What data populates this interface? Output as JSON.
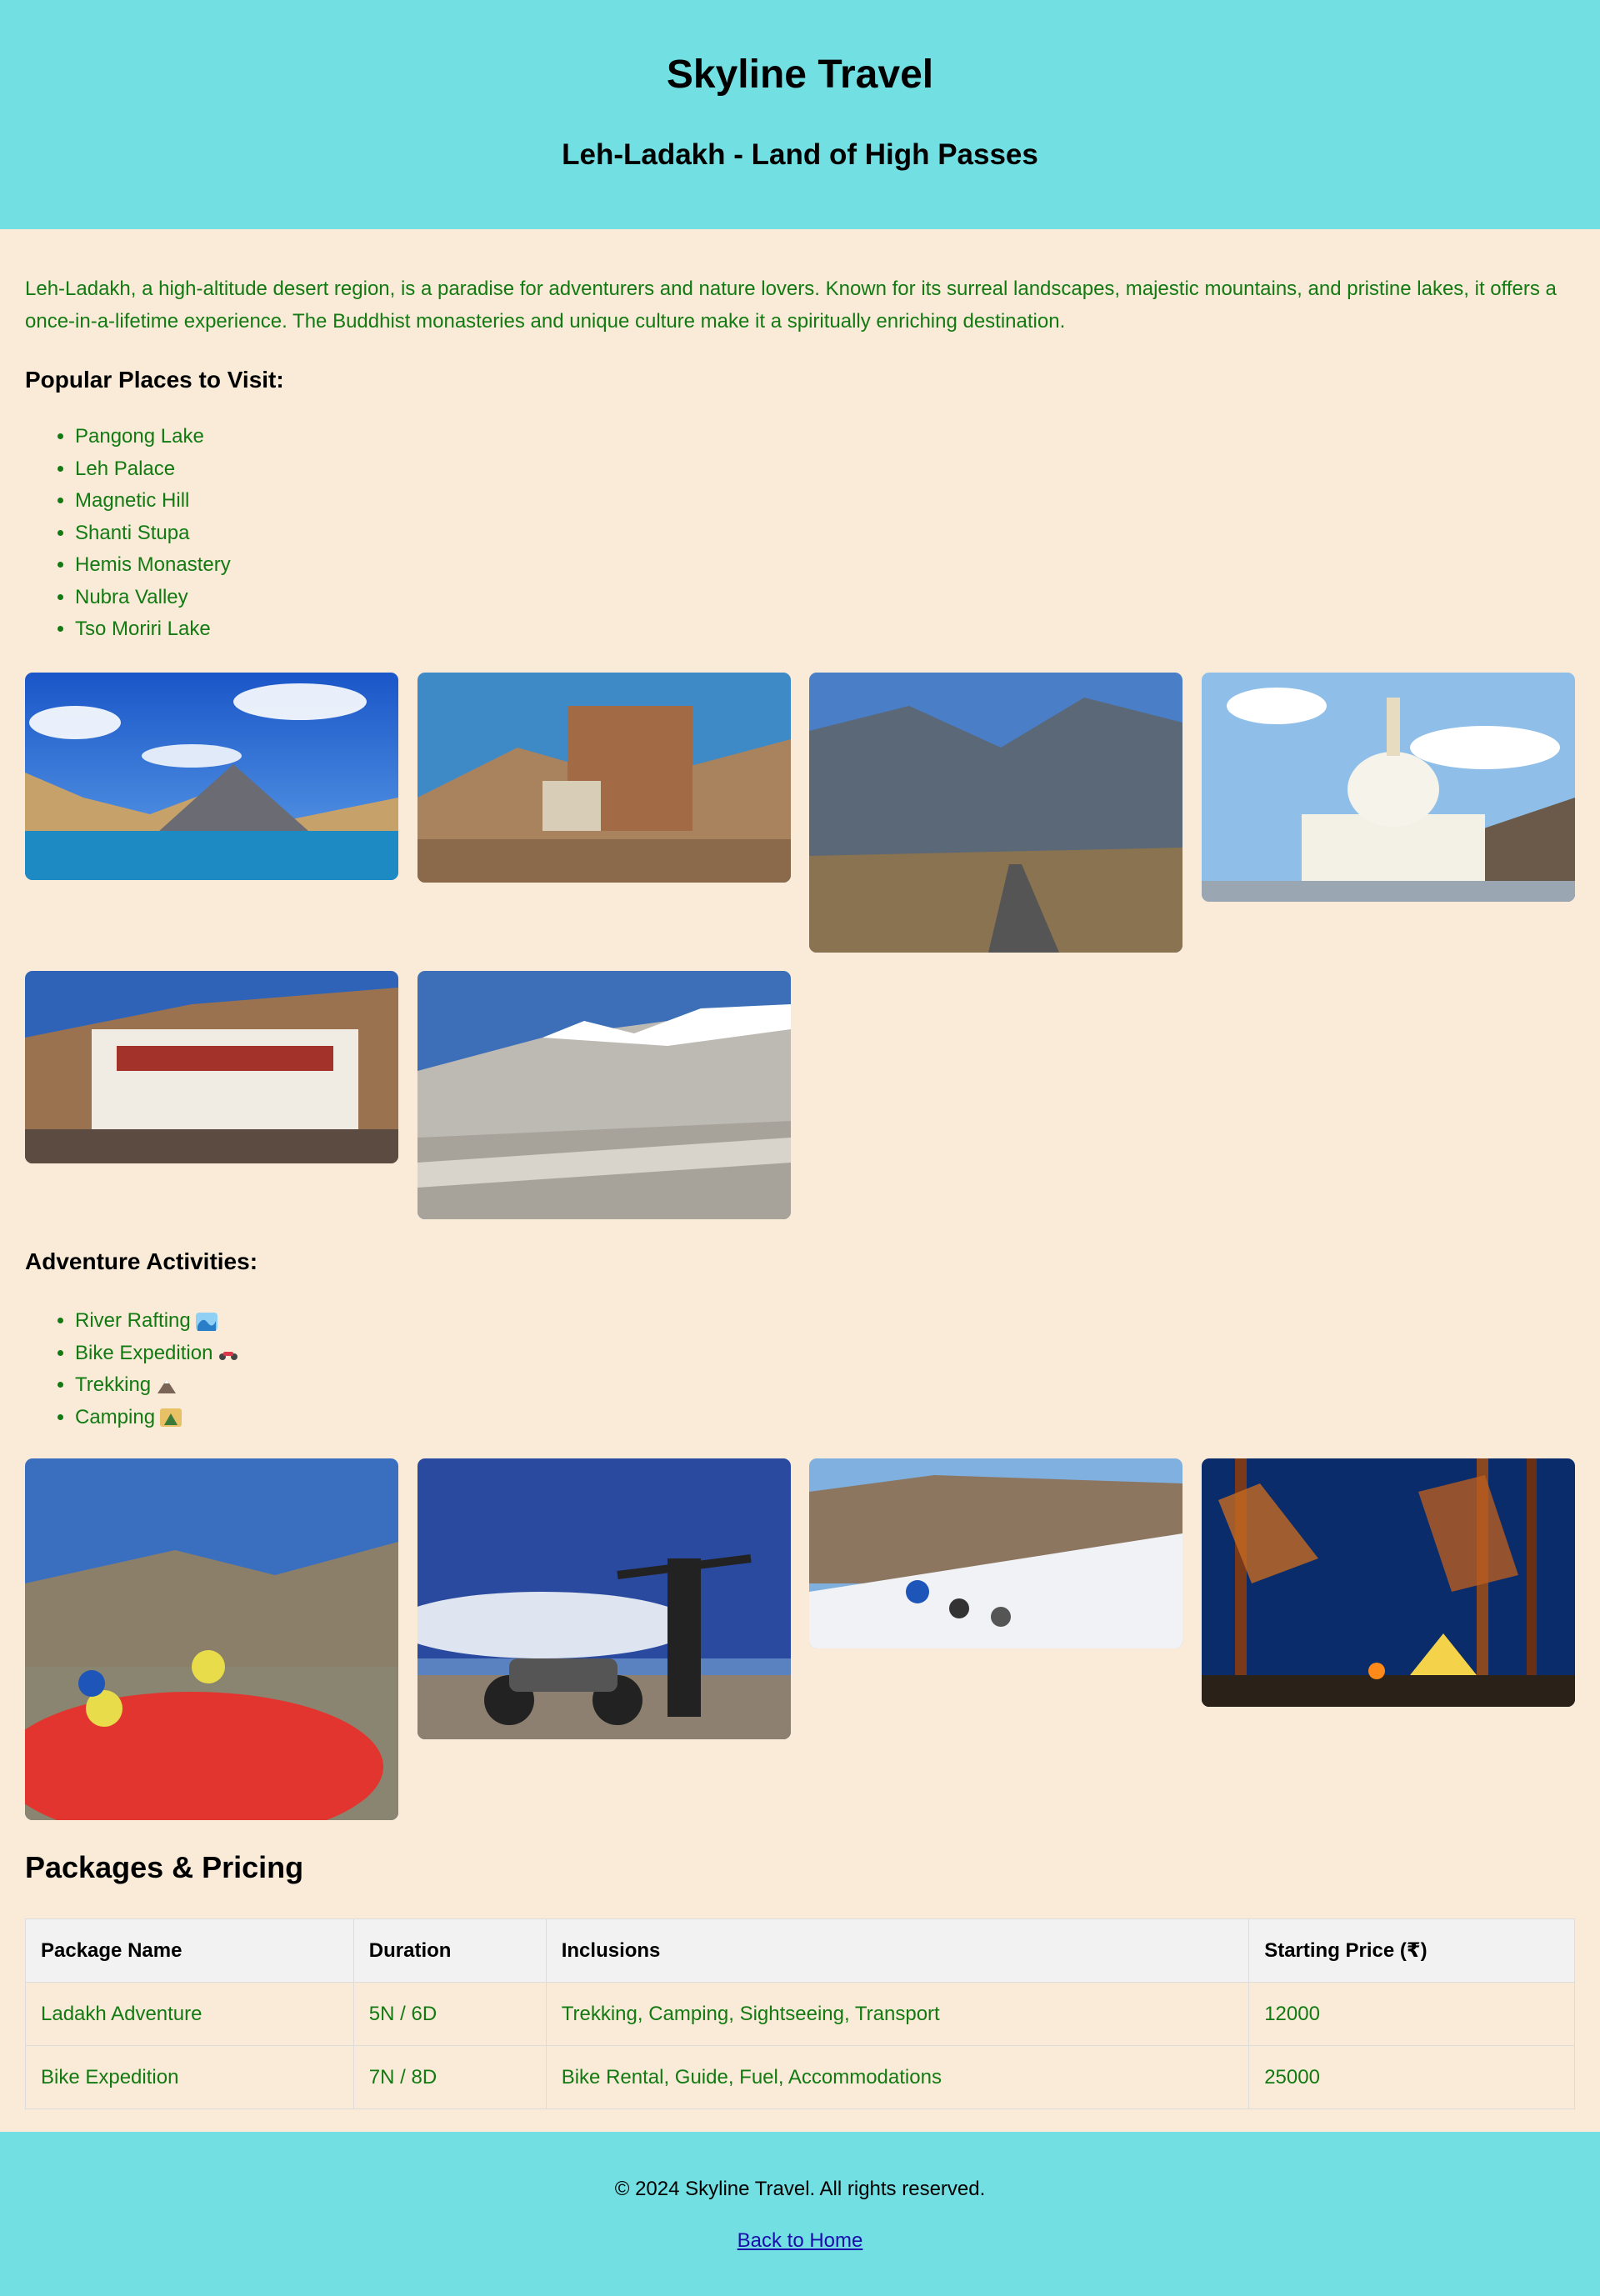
{
  "header": {
    "site_title": "Skyline Travel",
    "page_title": "Leh-Ladakh - Land of High Passes",
    "bg_color": "#72dfe3"
  },
  "intro": "Leh-Ladakh, a high-altitude desert region, is a paradise for adventurers and nature lovers. Known for its surreal landscapes, majestic mountains, and pristine lakes, it offers a once-in-a-lifetime experience. The Buddhist monasteries and unique culture make it a spiritually enriching destination.",
  "places": {
    "heading": "Popular Places to Visit:",
    "items": [
      "Pangong Lake",
      "Leh Palace",
      "Magnetic Hill",
      "Shanti Stupa",
      "Hemis Monastery",
      "Nubra Valley",
      "Tso Moriri Lake"
    ]
  },
  "activities": {
    "heading": "Adventure Activities:",
    "items": [
      {
        "label": "River Rafting",
        "icon": "wave-icon"
      },
      {
        "label": "Bike Expedition",
        "icon": "motorcycle-icon"
      },
      {
        "label": "Trekking",
        "icon": "mountain-icon"
      },
      {
        "label": "Camping",
        "icon": "camping-icon"
      }
    ]
  },
  "packages": {
    "heading": "Packages & Pricing",
    "columns": [
      "Package Name",
      "Duration",
      "Inclusions",
      "Starting Price (₹)"
    ],
    "rows": [
      [
        "Ladakh Adventure",
        "5N / 6D",
        "Trekking, Camping, Sightseeing, Transport",
        "12000"
      ],
      [
        "Bike Expedition",
        "7N / 8D",
        "Bike Rental, Guide, Fuel, Accommodations",
        "25000"
      ]
    ]
  },
  "footer": {
    "copyright": "© 2024 Skyline Travel. All rights reserved.",
    "back_link": "Back to Home"
  },
  "colors": {
    "page_bg": "#f9ebd7",
    "text_green": "#137a13",
    "link": "#1a0dab"
  }
}
